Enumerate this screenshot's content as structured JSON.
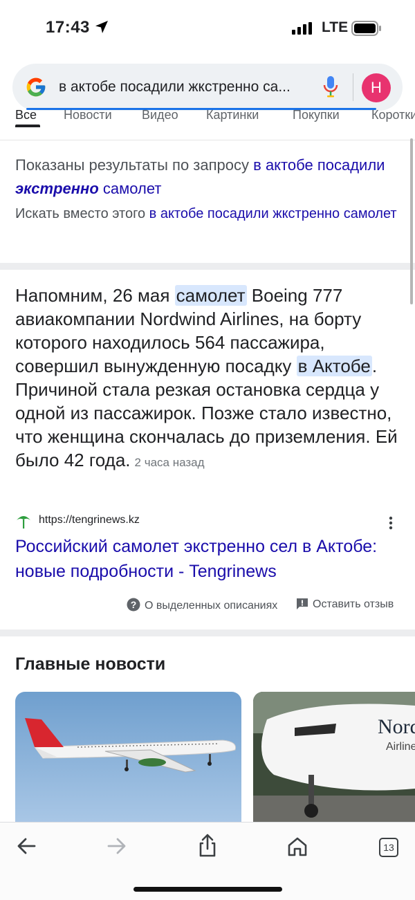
{
  "status_bar": {
    "time": "17:43",
    "network": "LTE"
  },
  "search": {
    "query": "в актобе посадили жкстренно са...",
    "avatar_letter": "H"
  },
  "tabs": [
    "Все",
    "Новости",
    "Видео",
    "Картинки",
    "Покупки",
    "Короткие"
  ],
  "spelling": {
    "showing_prefix": "Показаны результаты по запросу",
    "corrected_part1": "в актобе посадили",
    "corrected_bold": "экстренно",
    "corrected_part2": "самолет",
    "instead_prefix": "Искать вместо этого",
    "instead_query": "в актобе посадили жкстренно самолет"
  },
  "snippet": {
    "t1": "Напомним, 26 мая ",
    "h1": "самолет",
    "t2": " Boeing 777 авиакомпании Nordwind Airlines, на борту которого находилось 564 пассажира, совершил вынужденную посадку ",
    "h2": "в Актобе",
    "t3": ". Причиной стала резкая остановка сердца у одной из пассажирок. Позже стало известно, что женщина скончалась до приземления. Ей было 42 года.",
    "time_ago": "2 часа назад",
    "source_url": "https://tengrinews.kz",
    "result_title": "Российский самолет экстренно сел в Актобе: новые подробности - Tengrinews",
    "about_label": "О выделенных описаниях",
    "feedback_label": "Оставить отзыв"
  },
  "top_stories": {
    "title": "Главные новости",
    "card2_logo": "Nord",
    "card2_sub": "Airlines"
  },
  "toolbar": {
    "tab_count": "13"
  },
  "colors": {
    "link": "#1a0dab",
    "highlight": "#d8e7fd",
    "accent": "#1a73e8",
    "avatar": "#e8336f"
  }
}
